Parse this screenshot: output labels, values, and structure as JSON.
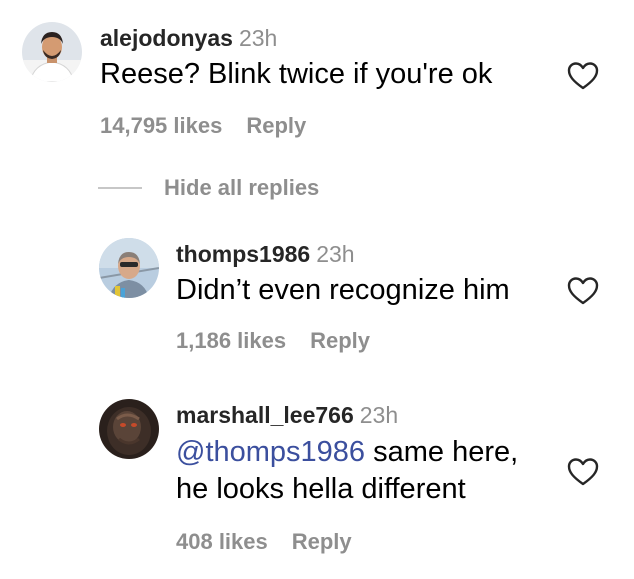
{
  "comments": [
    {
      "username": "alejodonyas",
      "time": "23h",
      "text": "Reese? Blink twice if you're ok",
      "likes": "14,795 likes",
      "reply": "Reply"
    }
  ],
  "hide_replies_label": "Hide all replies",
  "replies": [
    {
      "username": "thomps1986",
      "time": "23h",
      "text": "Didn’t even recognize him",
      "likes": "1,186 likes",
      "reply": "Reply"
    },
    {
      "username": "marshall_lee766",
      "time": "23h",
      "mention": "@thomps1986",
      "text_line1": " same here,",
      "text_line2": "he looks hella different",
      "likes": "408 likes",
      "reply": "Reply"
    }
  ],
  "icons": {
    "like": "heart-outline-icon"
  },
  "colors": {
    "mention": "#3b4f9e",
    "secondary_text": "#8e8e8e"
  }
}
